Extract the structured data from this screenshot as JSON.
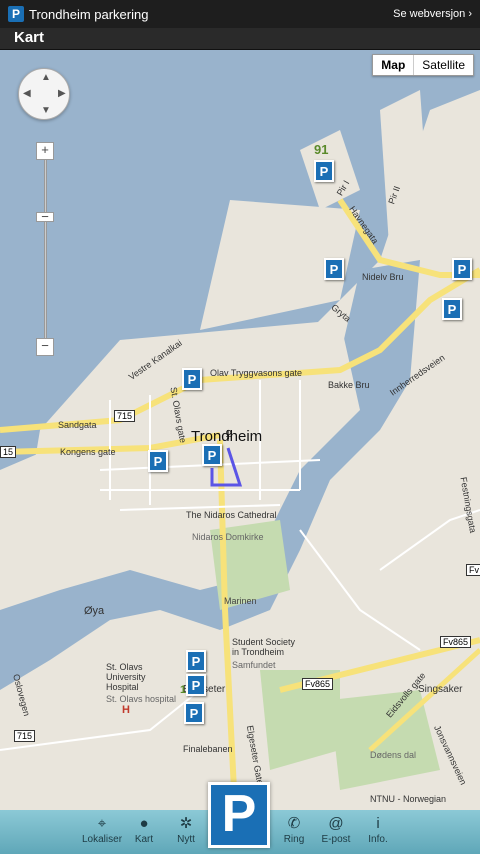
{
  "app": {
    "title": "Trondheim parkering",
    "logo": "P",
    "web_link": "Se webversjon"
  },
  "header": {
    "title": "Kart"
  },
  "map_controls": {
    "map_type": {
      "map": "Map",
      "satellite": "Satellite",
      "selected": "Map"
    },
    "zoom_in": "+",
    "zoom_out": "−",
    "zoom_mid": "−"
  },
  "map": {
    "city_label": "Trondheim",
    "roads": {
      "havnegata": "Havnegata",
      "nidelv_bru": "Nidelv Bru",
      "gryta": "Gryta",
      "olav": "Olav Tryggvasons gate",
      "bakke_bru": "Bakke Bru",
      "innherredsveien": "Innherredsveien",
      "vestre_kanalkai": "Vestre Kanalkai",
      "st_olavs_gate": "St. Olavs gate",
      "sandgata": "Sandgata",
      "kongens_gate": "Kongens gate",
      "elgeseter_gate": "Elgeseter Gate",
      "eidsvolls_gate": "Eidsvolls gate",
      "jonsvannsveien": "Jonsvannsveien",
      "festningsgata": "Festningsgata",
      "oslovegen": "Oslovegen",
      "pir1": "Pir I",
      "pir2": "Pir II"
    },
    "places": {
      "cathedral": "The Nidaros Cathedral",
      "cathedral_no": "Nidaros Domkirke",
      "marinen": "Marinen",
      "oya": "Øya",
      "student": "Student Society in Trondheim",
      "samfundet": "Samfundet",
      "hospital": "St. Olavs University Hospital",
      "hospital_no": "St. Olavs hospital",
      "elgeseter": "Elgeseter",
      "finalebanen": "Finalebanen",
      "singsaker": "Singsaker",
      "dodens_dal": "Dødens dal",
      "ntnu": "NTNU - Norwegian"
    },
    "shields": {
      "r715a": "715",
      "r715b": "715",
      "r15": "15",
      "fv865a": "Fv865",
      "fv865b": "Fv865",
      "fv": "Fv"
    },
    "parking_count_label": "91",
    "elgeseter_count": "135"
  },
  "tabs": [
    {
      "label": "Lokaliser",
      "icon": "crosshair-icon"
    },
    {
      "label": "Kart",
      "icon": "map-pin-icon"
    },
    {
      "label": "Nytt",
      "icon": "sprout-icon"
    },
    {
      "label": "Ring",
      "icon": "phone-icon"
    },
    {
      "label": "E-post",
      "icon": "at-icon"
    },
    {
      "label": "Info.",
      "icon": "info-icon"
    }
  ],
  "center_button": "P",
  "colors": {
    "water": "#99b3cc",
    "land": "#e9e5dc",
    "park": "#c5dbb0",
    "road": "#ffffff",
    "main_road": "#f7e27a",
    "parking": "#1a6fb5",
    "tabbar": "#7cbecd"
  }
}
